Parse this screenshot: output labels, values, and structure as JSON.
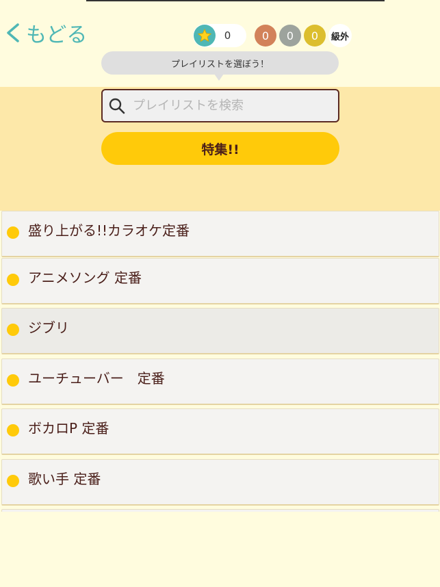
{
  "header": {
    "back_label": "もどる",
    "star_count": "0",
    "medals": {
      "bronze": "0",
      "silver": "0",
      "gold": "0"
    },
    "rank": "級外",
    "tooltip": "プレイリストを選ぼう！"
  },
  "search": {
    "placeholder": "プレイリストを検索",
    "value": ""
  },
  "special_button": "特集!!",
  "playlists": [
    {
      "label": "盛り上がる!!カラオケ定番"
    },
    {
      "label": "アニメソング 定番"
    },
    {
      "label": "ジブリ"
    },
    {
      "label": "ユーチューバー　定番"
    },
    {
      "label": "ボカロP 定番"
    },
    {
      "label": "歌い手 定番"
    }
  ],
  "colors": {
    "background": "#fffcde",
    "panel": "#fde8a9",
    "accent_teal": "#4fb7b5",
    "accent_yellow": "#ffca0a",
    "text": "#4a1f1a",
    "medal_bronze": "#d2825a",
    "medal_silver": "#9da39d",
    "medal_gold": "#dcbe2e"
  },
  "icons": {
    "back": "chevron-left-icon",
    "star": "star-icon",
    "search": "search-icon",
    "bullet": "dot-icon"
  }
}
